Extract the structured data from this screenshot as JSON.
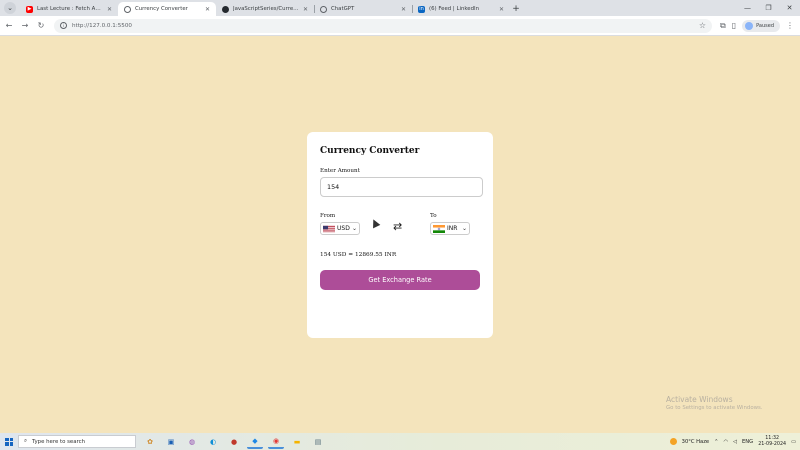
{
  "browser": {
    "tabs": [
      {
        "title": "Last Lecture : Fetch API with Fr...",
        "favicon": "youtube-icon",
        "color": "#ff0000",
        "active": false
      },
      {
        "title": "Currency Converter",
        "favicon": "globe-icon",
        "color": "#5f6368",
        "active": true
      },
      {
        "title": "JavaScriptSeries/CurrencyCon...",
        "favicon": "github-icon",
        "color": "#24292e",
        "active": false
      },
      {
        "title": "ChatGPT",
        "favicon": "chatgpt-icon",
        "color": "#74aa9c",
        "active": false
      },
      {
        "title": "(6) Feed | LinkedIn",
        "favicon": "linkedin-icon",
        "color": "#0a66c2",
        "active": false
      }
    ],
    "url": "http://127.0.0.1:5500",
    "profile_label": "Paused"
  },
  "app": {
    "title": "Currency Converter",
    "amount_label": "Enter Amount",
    "amount_value": "154",
    "from_label": "From",
    "to_label": "To",
    "from_currency": "USD",
    "to_currency": "INR",
    "result": "154 USD = 12869.55 INR",
    "button_label": "Get Exchange Rate"
  },
  "watermark": {
    "line1": "Activate Windows",
    "line2": "Go to Settings to activate Windows."
  },
  "taskbar": {
    "search_placeholder": "Type here to search",
    "weather": "30°C  Haze",
    "language": "ENG",
    "time": "11:32",
    "date": "21-09-2024"
  },
  "colors": {
    "page_background": "#f4e4bc",
    "button": "#ad4d98"
  }
}
